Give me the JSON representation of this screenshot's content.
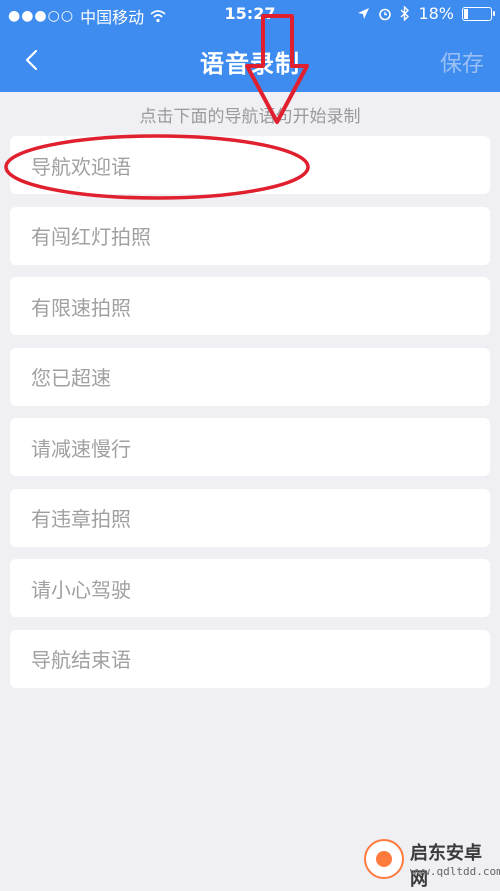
{
  "status_bar": {
    "signal_dots": "●●●○○",
    "carrier": "中国移动",
    "time": "15:27",
    "battery": "18%",
    "icons": [
      "signal-icon",
      "wifi-icon",
      "location-icon",
      "alarm-icon",
      "bluetooth-icon",
      "battery-icon"
    ]
  },
  "nav": {
    "back_icon": "chevron-left-icon",
    "title": "语音录制",
    "save_label": "保存"
  },
  "hint": "点击下面的导航语句开始录制",
  "items": [
    {
      "label": "导航欢迎语"
    },
    {
      "label": "有闯红灯拍照"
    },
    {
      "label": "有限速拍照"
    },
    {
      "label": "您已超速"
    },
    {
      "label": "请减速慢行"
    },
    {
      "label": "有违章拍照"
    },
    {
      "label": "请小心驾驶"
    },
    {
      "label": "导航结束语"
    }
  ],
  "watermark": {
    "name": "启东安卓网",
    "url": "www.qdltdd.com"
  },
  "colors": {
    "header": "#3f8cf0",
    "background": "#efeff4",
    "annotation": "#e0202e"
  }
}
